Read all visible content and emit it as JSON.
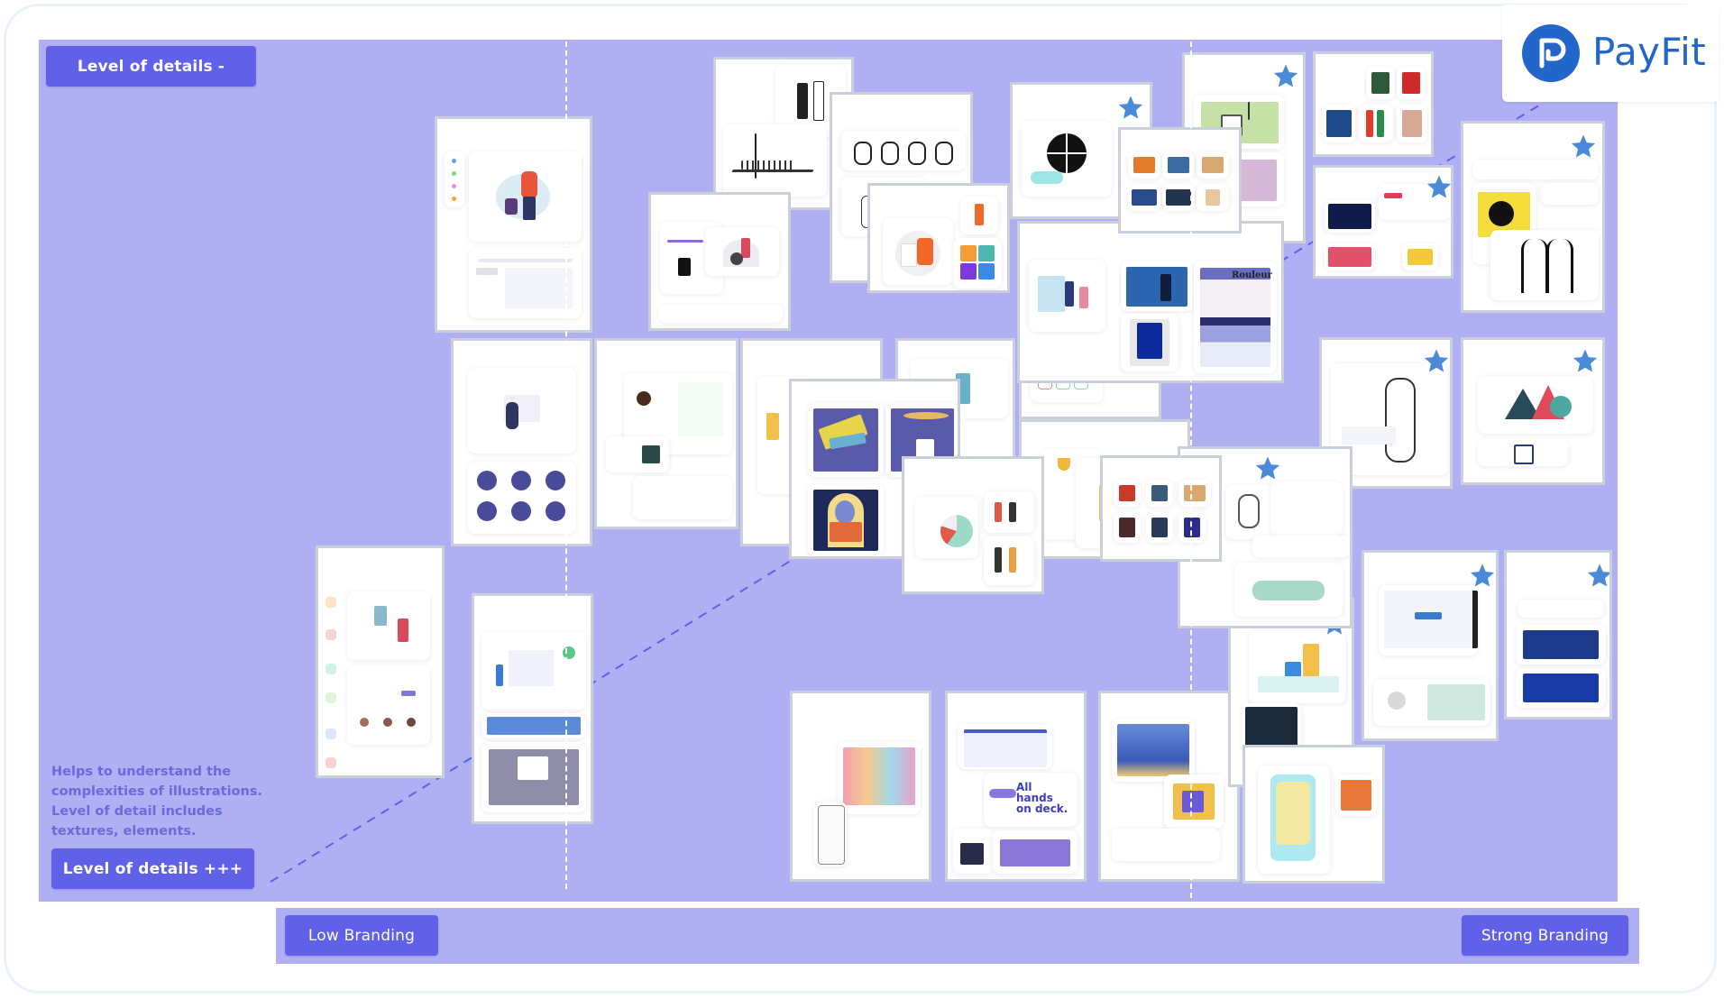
{
  "brand": {
    "name": "PayFit",
    "logo_icon": "payfit-p-icon",
    "color": "#2366ca"
  },
  "axes": {
    "y_top_label": "Level of details -",
    "y_bottom_label": "Level of details +++",
    "y_description": "Helps to understand the complexities of illustrations. Level of detail includes textures, elements.",
    "x_left_label": "Low Branding",
    "x_right_label": "Strong Branding"
  },
  "colors": {
    "board": "#b1aff4",
    "button": "#6160e9",
    "note_text": "#6a69df",
    "star": "#4a8ad8",
    "card_border": "#c9d0dc"
  },
  "card_texts": {
    "rouleur": "Rouleur",
    "all_hands": "All hands on deck."
  },
  "favorites": {
    "starred_count": 10,
    "star_icon": "star-icon"
  }
}
